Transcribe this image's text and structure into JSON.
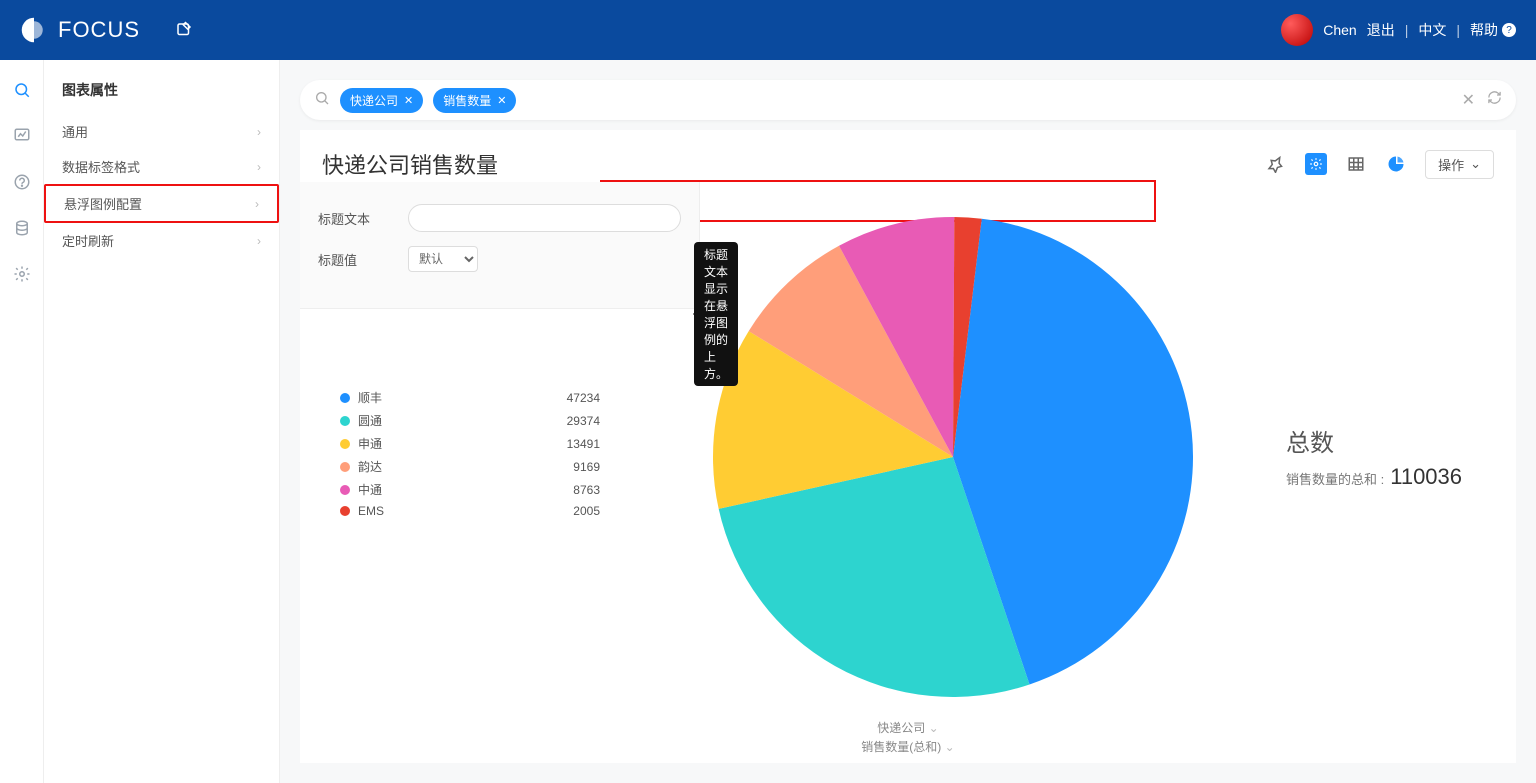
{
  "brand": "FOCUS",
  "top": {
    "user": "Chen",
    "logout": "退出",
    "lang": "中文",
    "help": "帮助"
  },
  "side": {
    "title": "图表属性",
    "items": [
      "通用",
      "数据标签格式",
      "悬浮图例配置",
      "定时刷新"
    ]
  },
  "search": {
    "chips": [
      "快递公司",
      "销售数量"
    ]
  },
  "chart_title": "快递公司销售数量",
  "config": {
    "title_text_label": "标题文本",
    "title_value_label": "标题值",
    "select_default": "默认"
  },
  "tooltip": "标题文本显示在悬浮图例的上方。",
  "totals": {
    "label": "总数",
    "sub": "销售数量的总和 :",
    "value": "110036"
  },
  "op": "操作",
  "axis": {
    "a": "快递公司",
    "b": "销售数量(总和)"
  },
  "colors": {
    "sf": "#1e90ff",
    "yt": "#2dd4cf",
    "st": "#ffcc33",
    "yd": "#ff9e7a",
    "zt": "#e85bb5",
    "ems": "#e8402f"
  },
  "chart_data": {
    "type": "pie",
    "title": "快递公司销售数量",
    "series": [
      {
        "name": "销售数量",
        "values": [
          47234,
          29374,
          13491,
          9169,
          8763,
          2005
        ]
      }
    ],
    "categories": [
      "顺丰",
      "圆通",
      "申通",
      "韵达",
      "中通",
      "EMS"
    ],
    "total": 110036,
    "legend_position": "left"
  }
}
